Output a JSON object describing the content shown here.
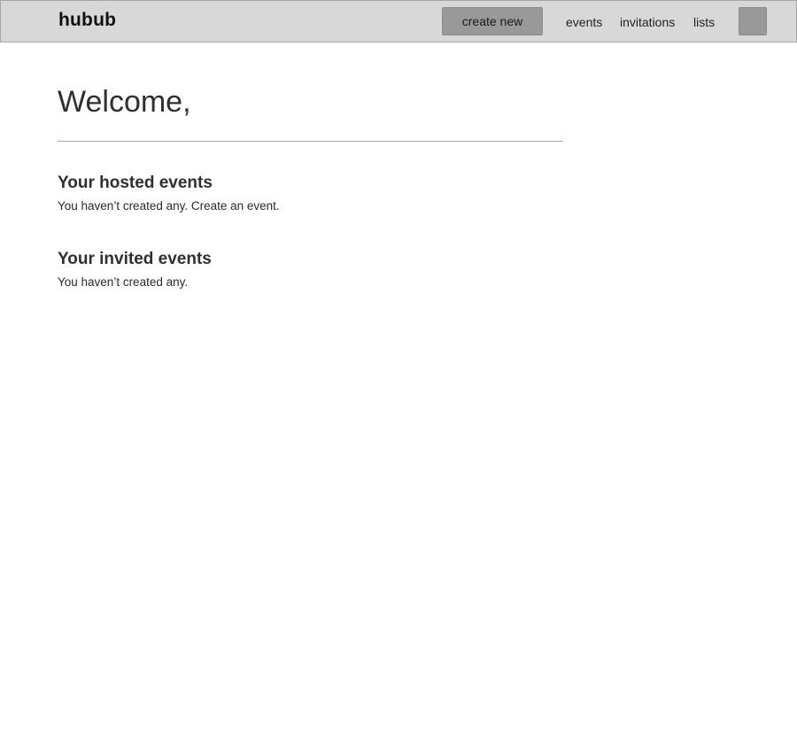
{
  "navbar": {
    "brand": "hubub",
    "create_button": "create new",
    "links": {
      "events": "events",
      "invitations": "invitations",
      "lists": "lists"
    }
  },
  "main": {
    "welcome": "Welcome,",
    "hosted": {
      "title": "Your hosted events",
      "empty_text": "You haven’t created any.",
      "create_link": "Create an event."
    },
    "invited": {
      "title": "Your invited events",
      "empty_text": "You haven’t created any."
    }
  }
}
